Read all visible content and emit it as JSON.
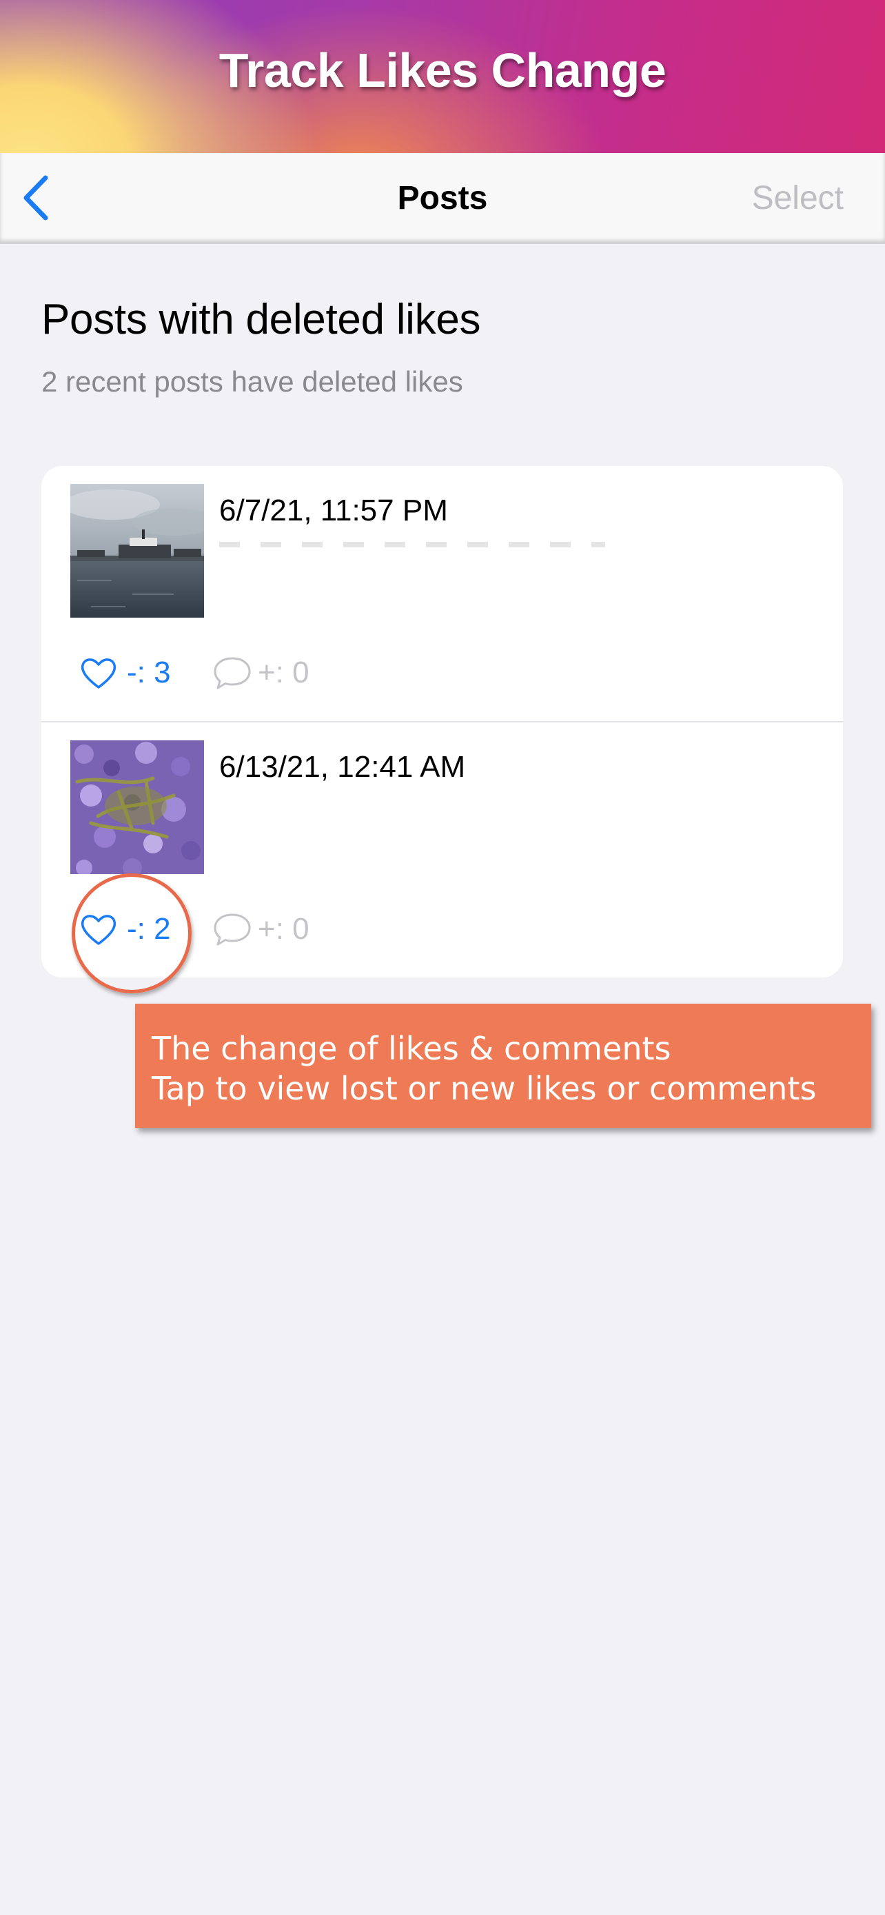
{
  "banner": {
    "title": "Track Likes Change"
  },
  "navbar": {
    "back_icon": "chevron-left-icon",
    "title": "Posts",
    "select_label": "Select"
  },
  "header": {
    "title": "Posts with deleted likes",
    "subtitle": "2 recent posts have deleted likes"
  },
  "posts": [
    {
      "date": "6/7/21, 11:57 PM",
      "likes_change": "-: 3",
      "comments_change": "+: 0",
      "thumbnail": "harbor-photo"
    },
    {
      "date": "6/13/21, 12:41 AM",
      "likes_change": "-: 2",
      "comments_change": "+: 0",
      "thumbnail": "aquarium-photo"
    }
  ],
  "callout": {
    "line1": "The change of likes & comments",
    "line2": "Tap to view lost or new likes or comments"
  },
  "colors": {
    "accent_blue": "#1a7cf4",
    "callout_orange": "#ee7b55",
    "ring_orange": "#e86a4b",
    "muted_gray": "#c4c4c8"
  }
}
